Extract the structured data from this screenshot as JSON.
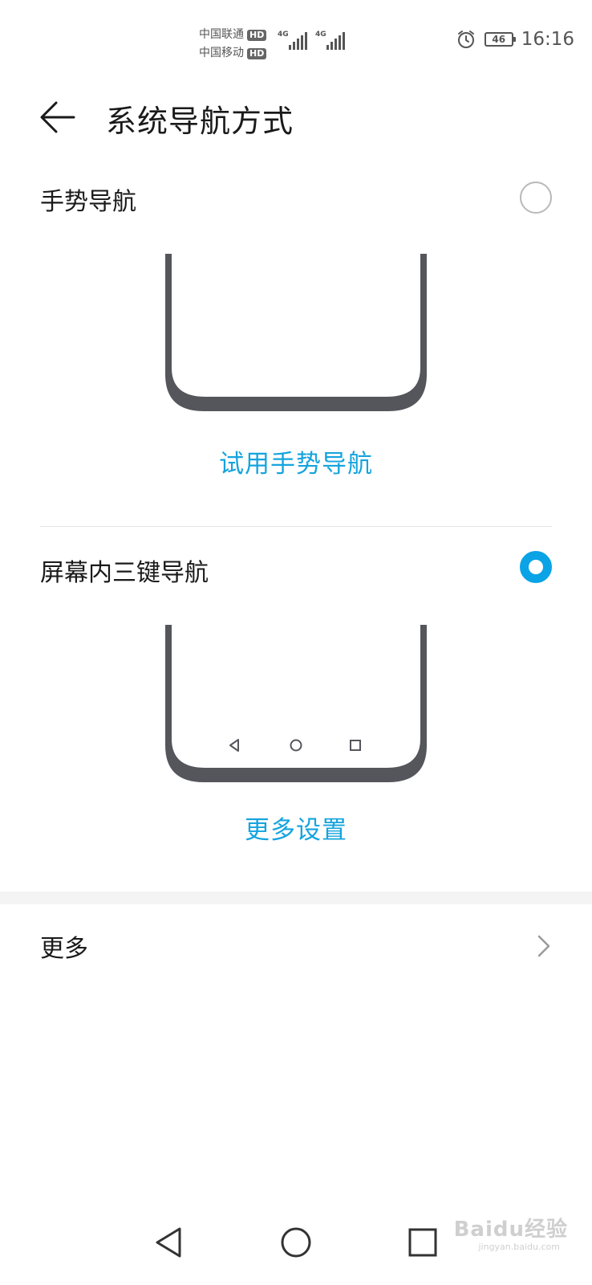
{
  "status_bar": {
    "carrier1": "中国联通",
    "carrier2": "中国移动",
    "hd_label": "HD",
    "network1": "4G",
    "network2": "4G",
    "battery": "46",
    "time": "16:16"
  },
  "header": {
    "title": "系统导航方式"
  },
  "options": [
    {
      "label": "手势导航",
      "selected": false,
      "action": "试用手势导航"
    },
    {
      "label": "屏幕内三键导航",
      "selected": true,
      "action": "更多设置"
    }
  ],
  "more": {
    "label": "更多"
  },
  "accent_color": "#0aa3e6",
  "watermark": {
    "text": "Baidu经验",
    "sub": "jingyan.baidu.com"
  }
}
